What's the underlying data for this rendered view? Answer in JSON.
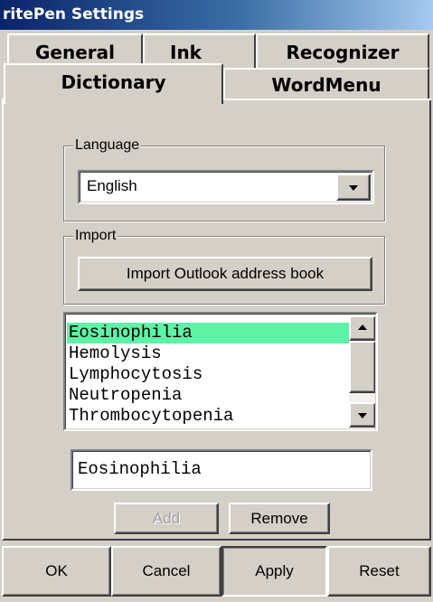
{
  "window": {
    "title": "ritePen Settings"
  },
  "tabs": {
    "row1": [
      "General",
      "Ink",
      "Recognizer"
    ],
    "row2": [
      "Dictionary",
      "WordMenu"
    ],
    "active": "Dictionary"
  },
  "language": {
    "legend": "Language",
    "selected": "English"
  },
  "import": {
    "legend": "Import",
    "button_label": "Import Outlook address book"
  },
  "dictionary": {
    "items": [
      "Eosinophilia",
      "Hemolysis",
      "Lymphocytosis",
      "Neutropenia",
      "Thrombocytopenia"
    ],
    "selected_index": 0,
    "entry_value": "Eosinophilia"
  },
  "actions": {
    "add_label": "Add",
    "remove_label": "Remove"
  },
  "footer": {
    "ok_label": "OK",
    "cancel_label": "Cancel",
    "apply_label": "Apply",
    "reset_label": "Reset"
  },
  "colors": {
    "titlebar_start": "#0a246a",
    "titlebar_end": "#a6caf0",
    "selection": "#5ef2a6",
    "face": "#d4d0c8"
  }
}
